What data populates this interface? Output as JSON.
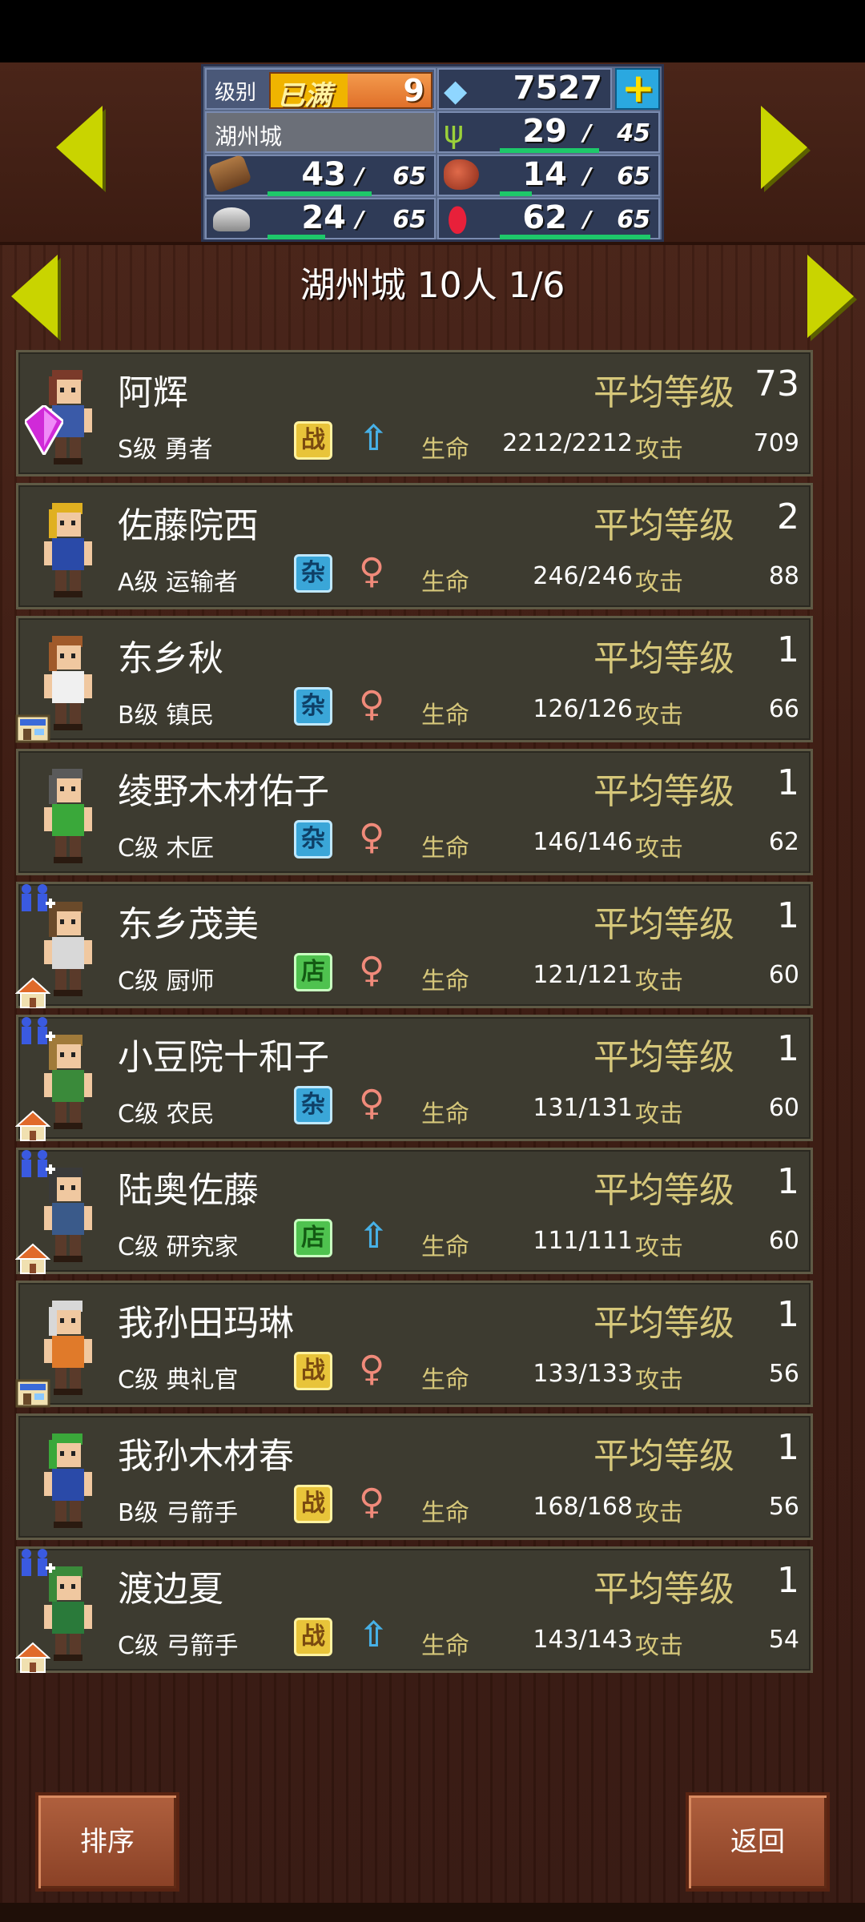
{
  "header": {
    "level_label": "级别",
    "level_badge": "已满",
    "level_value": "9",
    "gems": "7527",
    "city_name": "湖州城",
    "resources": [
      {
        "icon": "grass-icon",
        "value": "29",
        "max": "45",
        "fill": 0.64
      },
      {
        "icon": "wood-log-icon",
        "value": "43",
        "max": "65",
        "fill": 0.66
      },
      {
        "icon": "food-meat-icon",
        "value": "14",
        "max": "65",
        "fill": 0.22
      },
      {
        "icon": "stone-ore-icon",
        "value": "24",
        "max": "65",
        "fill": 0.37
      },
      {
        "icon": "red-gem-icon",
        "value": "62",
        "max": "65",
        "fill": 0.95
      }
    ]
  },
  "page": {
    "title": "湖州城  10人 1/6"
  },
  "residents": [
    {
      "name": "阿辉",
      "avg_label": "平均等级",
      "avg": "73",
      "rank": "S级 勇者",
      "tag": "战",
      "tag_type": "war",
      "gender": "male",
      "hp_label": "生命",
      "hp": "2212/2212",
      "atk_label": "攻击",
      "atk": "709"
    },
    {
      "name": "佐藤院西",
      "avg_label": "平均等级",
      "avg": "2",
      "rank": "A级 运输者",
      "tag": "杂",
      "tag_type": "misc",
      "gender": "female",
      "hp_label": "生命",
      "hp": "246/246",
      "atk_label": "攻击",
      "atk": "88"
    },
    {
      "name": "东乡秋",
      "avg_label": "平均等级",
      "avg": "1",
      "rank": "B级 镇民",
      "tag": "杂",
      "tag_type": "misc",
      "gender": "female",
      "hp_label": "生命",
      "hp": "126/126",
      "atk_label": "攻击",
      "atk": "66"
    },
    {
      "name": "绫野木材佑子",
      "avg_label": "平均等级",
      "avg": "1",
      "rank": "C级 木匠",
      "tag": "杂",
      "tag_type": "misc",
      "gender": "female",
      "hp_label": "生命",
      "hp": "146/146",
      "atk_label": "攻击",
      "atk": "62"
    },
    {
      "name": "东乡茂美",
      "avg_label": "平均等级",
      "avg": "1",
      "rank": "C级 厨师",
      "tag": "店",
      "tag_type": "shop",
      "gender": "female",
      "hp_label": "生命",
      "hp": "121/121",
      "atk_label": "攻击",
      "atk": "60"
    },
    {
      "name": "小豆院十和子",
      "avg_label": "平均等级",
      "avg": "1",
      "rank": "C级 农民",
      "tag": "杂",
      "tag_type": "misc",
      "gender": "female",
      "hp_label": "生命",
      "hp": "131/131",
      "atk_label": "攻击",
      "atk": "60"
    },
    {
      "name": "陆奥佐藤",
      "avg_label": "平均等级",
      "avg": "1",
      "rank": "C级 研究家",
      "tag": "店",
      "tag_type": "shop",
      "gender": "male",
      "hp_label": "生命",
      "hp": "111/111",
      "atk_label": "攻击",
      "atk": "60"
    },
    {
      "name": "我孙田玛琳",
      "avg_label": "平均等级",
      "avg": "1",
      "rank": "C级 典礼官",
      "tag": "战",
      "tag_type": "war",
      "gender": "female",
      "hp_label": "生命",
      "hp": "133/133",
      "atk_label": "攻击",
      "atk": "56"
    },
    {
      "name": "我孙木材春",
      "avg_label": "平均等级",
      "avg": "1",
      "rank": "B级 弓箭手",
      "tag": "战",
      "tag_type": "war",
      "gender": "female",
      "hp_label": "生命",
      "hp": "168/168",
      "atk_label": "攻击",
      "atk": "56"
    },
    {
      "name": "渡边夏",
      "avg_label": "平均等级",
      "avg": "1",
      "rank": "C级 弓箭手",
      "tag": "战",
      "tag_type": "war",
      "gender": "male",
      "hp_label": "生命",
      "hp": "143/143",
      "atk_label": "攻击",
      "atk": "54"
    }
  ],
  "buttons": {
    "sort": "排序",
    "back": "返回"
  },
  "colors": {
    "accent_arrow": "#c9d400",
    "label_gold": "#d6c77a",
    "bar_green": "#1ec86a"
  }
}
